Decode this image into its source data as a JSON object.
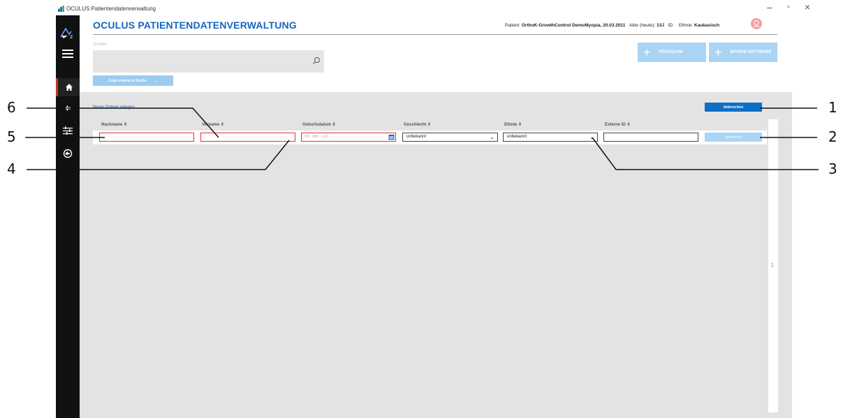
{
  "window": {
    "title": "OCULUS Patientendatenverwaltung",
    "minimize": "–",
    "restore": "▫",
    "close": "×"
  },
  "app": {
    "title": "OCULUS PATIENTENDATENVERWALTUNG"
  },
  "patient": {
    "label": "Patient:",
    "name": "OrthoK-GrowthControl DemoMyopia, 20.03.2011",
    "age_label": "Alter (heute):",
    "age": "13J",
    "id_label": "ID:",
    "ethnie_label": "Ethnie:",
    "ethnie": "Kaukasisch"
  },
  "search": {
    "label": "Suchen",
    "advanced_label": "Zeige erweiterte Suche",
    "advanced_chevron": "⌄"
  },
  "top_buttons": {
    "pentacam": "PENTACAM",
    "myopie": "MYOPIE SOFTWARE"
  },
  "form": {
    "title": "Neuer Patient anlegen",
    "cancel": "Abbrechen",
    "save": "Speichern",
    "columns": [
      "Nachname ⇕",
      "Vorname ⇕",
      "Geburtsdatum ⇕",
      "Geschlecht ⇕",
      "Ethnie ⇕",
      "Externe ID ⇕"
    ],
    "date_placeholder": "DD . MM . JJJJ",
    "gender_value": "unbekannt",
    "ethnie_value": "unbekannt"
  },
  "callouts": [
    "1",
    "2",
    "3",
    "4",
    "5",
    "6"
  ],
  "colors": {
    "accent": "#1565c0",
    "sidebar": "#111111",
    "invalid": "#dd3333",
    "button_light": "#a9d4f5"
  }
}
